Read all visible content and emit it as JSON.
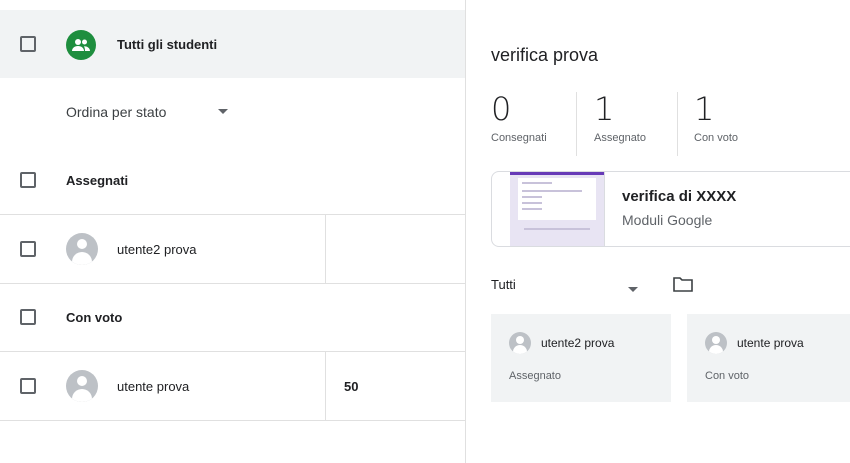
{
  "roster": {
    "all_students_label": "Tutti gli studenti",
    "sort_label": "Ordina per stato",
    "sections": [
      {
        "label": "Assegnati",
        "students": [
          {
            "name": "utente2 prova",
            "grade": ""
          }
        ]
      },
      {
        "label": "Con voto",
        "students": [
          {
            "name": "utente prova",
            "grade": "50"
          }
        ]
      }
    ]
  },
  "assignment": {
    "title": "verifica prova",
    "stats": [
      {
        "value": "0",
        "label": "Consegnati"
      },
      {
        "value": "1",
        "label": "Assegnato"
      },
      {
        "value": "1",
        "label": "Con voto"
      }
    ],
    "attachment": {
      "name": "verifica di XXXX",
      "type": "Moduli Google"
    },
    "filter_label": "Tutti",
    "student_cards": [
      {
        "name": "utente2 prova",
        "status": "Assegnato"
      },
      {
        "name": "utente prova",
        "status": "Con voto"
      }
    ]
  },
  "colors": {
    "group_icon": "#1e8e3e",
    "form_accent": "#673ab7",
    "highlight_bg": "#f1f3f4"
  },
  "icons": [
    "group-icon",
    "avatar-icon",
    "chevron-down-icon",
    "folder-icon"
  ]
}
